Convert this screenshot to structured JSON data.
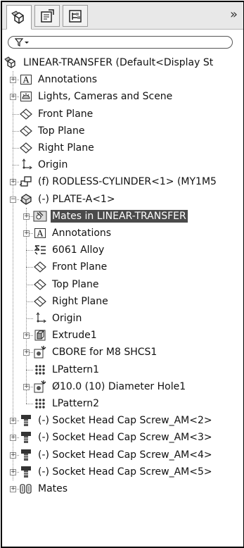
{
  "header": {
    "more_label": "»"
  },
  "tree": [
    {
      "label": "LINEAR-TRANSFER  (Default<Display St",
      "icon": "assembly-icon",
      "level": 0,
      "expander": "none",
      "name": "tree-item-linear-transfer"
    },
    {
      "label": "Annotations",
      "icon": "annotation-icon",
      "level": 1,
      "expander": "plus",
      "name": "tree-item-annotations"
    },
    {
      "label": "Lights, Cameras and Scene",
      "icon": "lights-icon",
      "level": 1,
      "expander": "plus",
      "name": "tree-item-lights-cameras-scene"
    },
    {
      "label": "Front Plane",
      "icon": "plane-icon",
      "level": 1,
      "expander": "none",
      "name": "tree-item-front-plane"
    },
    {
      "label": "Top Plane",
      "icon": "plane-icon",
      "level": 1,
      "expander": "none",
      "name": "tree-item-top-plane"
    },
    {
      "label": "Right Plane",
      "icon": "plane-icon",
      "level": 1,
      "expander": "none",
      "name": "tree-item-right-plane"
    },
    {
      "label": "Origin",
      "icon": "origin-icon",
      "level": 1,
      "expander": "none",
      "name": "tree-item-origin"
    },
    {
      "label": "(f) RODLESS-CYLINDER<1> (MY1M5",
      "icon": "subassembly-icon",
      "level": 1,
      "expander": "plus",
      "name": "tree-item-rodless-cylinder"
    },
    {
      "label": "(-) PLATE-A<1>",
      "icon": "part-icon",
      "level": 1,
      "expander": "minus",
      "name": "tree-item-plate-a"
    },
    {
      "label": "Mates in LINEAR-TRANSFER",
      "icon": "mates-folder-icon",
      "level": 2,
      "expander": "plus",
      "selected": true,
      "name": "tree-item-mates-in-linear-transfer"
    },
    {
      "label": "Annotations",
      "icon": "annotation-icon",
      "level": 2,
      "expander": "plus",
      "name": "tree-item-plate-annotations"
    },
    {
      "label": "6061 Alloy",
      "icon": "material-icon",
      "level": 2,
      "expander": "none",
      "name": "tree-item-material"
    },
    {
      "label": "Front Plane",
      "icon": "plane-icon",
      "level": 2,
      "expander": "none",
      "name": "tree-item-plate-front-plane"
    },
    {
      "label": "Top Plane",
      "icon": "plane-icon",
      "level": 2,
      "expander": "none",
      "name": "tree-item-plate-top-plane"
    },
    {
      "label": "Right Plane",
      "icon": "plane-icon",
      "level": 2,
      "expander": "none",
      "name": "tree-item-plate-right-plane"
    },
    {
      "label": "Origin",
      "icon": "origin-icon",
      "level": 2,
      "expander": "none",
      "name": "tree-item-plate-origin"
    },
    {
      "label": "Extrude1",
      "icon": "extrude-icon",
      "level": 2,
      "expander": "plus",
      "name": "tree-item-extrude1"
    },
    {
      "label": "CBORE for M8 SHCS1",
      "icon": "hole-wizard-icon",
      "level": 2,
      "expander": "plus",
      "name": "tree-item-cbore"
    },
    {
      "label": "LPattern1",
      "icon": "pattern-icon",
      "level": 2,
      "expander": "none",
      "name": "tree-item-lpattern1"
    },
    {
      "label": "Ø10.0 (10) Diameter Hole1",
      "icon": "hole-wizard-icon",
      "level": 2,
      "expander": "plus",
      "name": "tree-item-diameter-hole"
    },
    {
      "label": "LPattern2",
      "icon": "pattern-icon",
      "level": 2,
      "expander": "none",
      "name": "tree-item-lpattern2"
    },
    {
      "label": "(-) Socket Head Cap Screw_AM<2>",
      "icon": "screw-icon",
      "level": 1,
      "expander": "plus",
      "name": "tree-item-screw-2"
    },
    {
      "label": "(-) Socket Head Cap Screw_AM<3>",
      "icon": "screw-icon",
      "level": 1,
      "expander": "plus",
      "name": "tree-item-screw-3"
    },
    {
      "label": "(-) Socket Head Cap Screw_AM<4>",
      "icon": "screw-icon",
      "level": 1,
      "expander": "plus",
      "name": "tree-item-screw-4"
    },
    {
      "label": "(-) Socket Head Cap Screw_AM<5>",
      "icon": "screw-icon",
      "level": 1,
      "expander": "plus",
      "name": "tree-item-screw-5"
    },
    {
      "label": "Mates",
      "icon": "mates-icon",
      "level": 1,
      "expander": "plus",
      "name": "tree-item-mates"
    }
  ]
}
